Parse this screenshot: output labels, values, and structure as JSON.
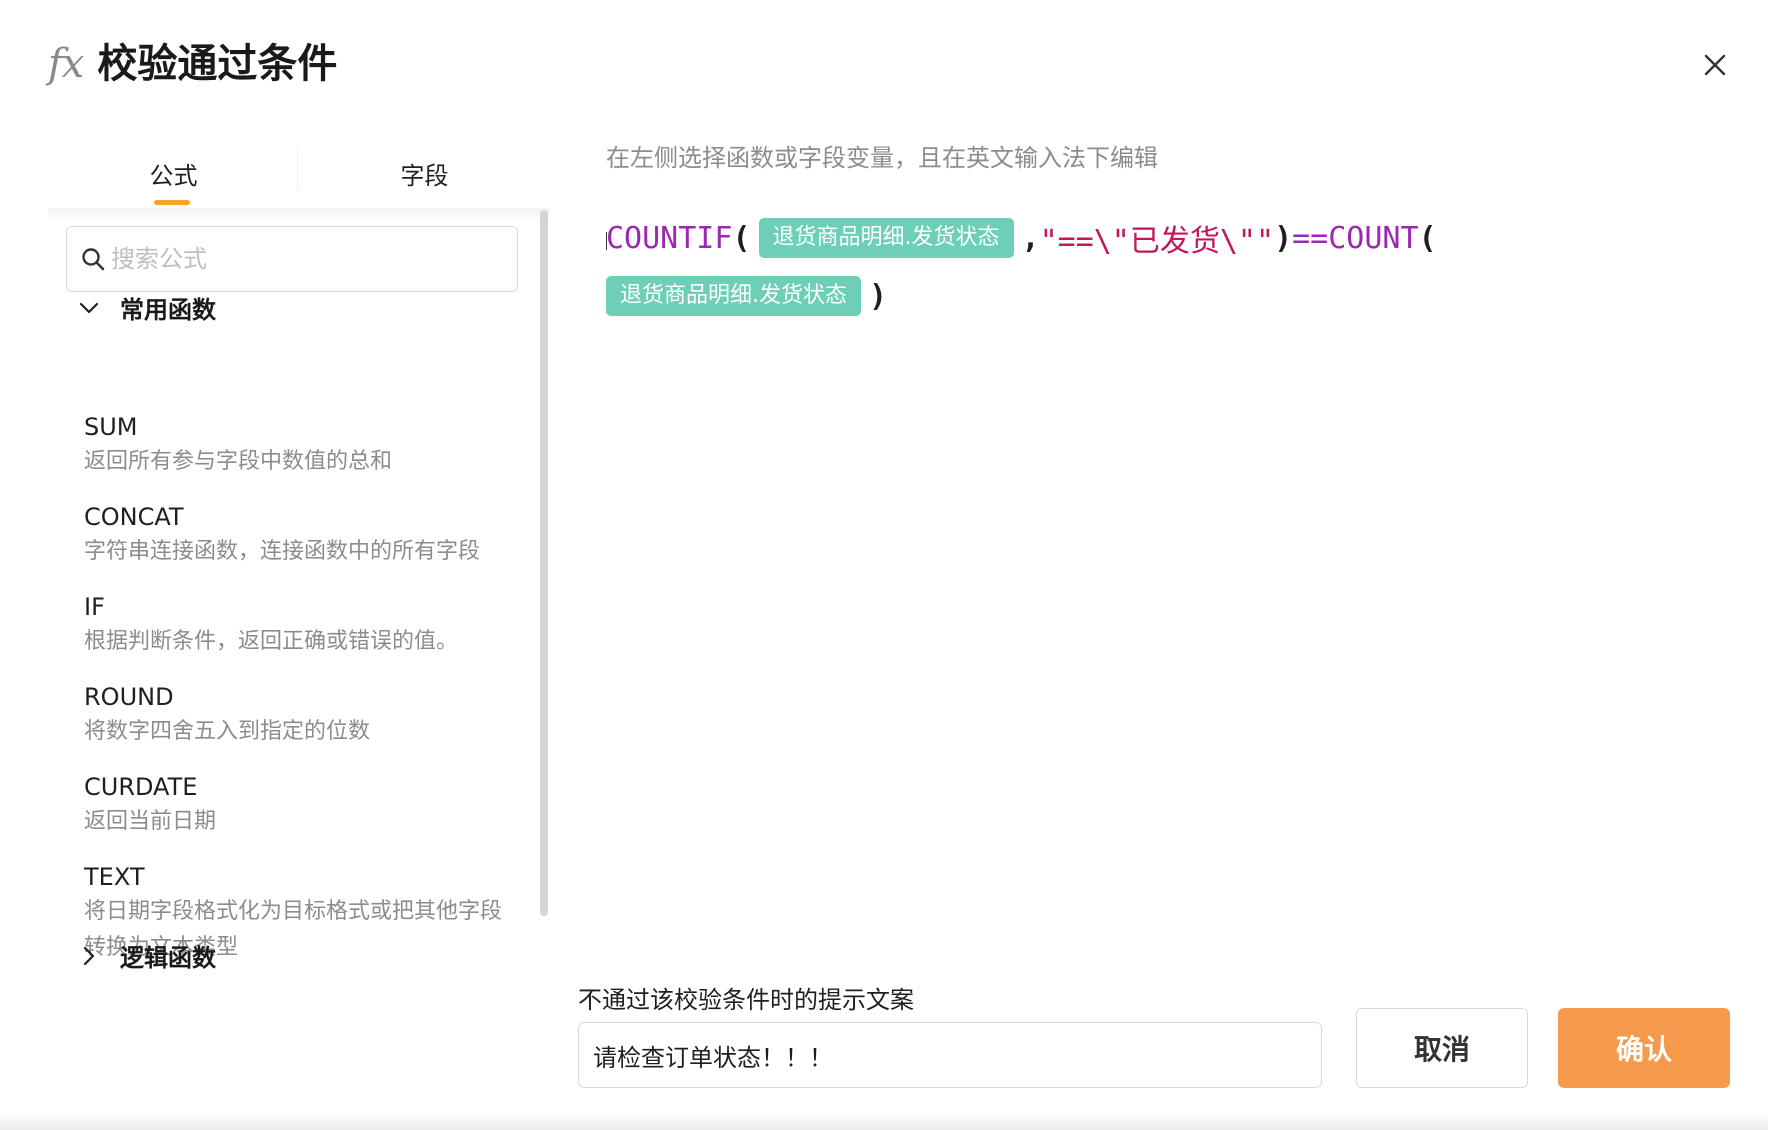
{
  "dialog": {
    "fx_symbol": "fx",
    "title": "校验通过条件"
  },
  "tabs": [
    {
      "label": "公式",
      "active": true
    },
    {
      "label": "字段",
      "active": false
    }
  ],
  "search": {
    "placeholder": "搜索公式",
    "value": ""
  },
  "groups": [
    {
      "label": "常用函数",
      "expanded": true
    },
    {
      "label": "逻辑函数",
      "expanded": false
    }
  ],
  "functions": [
    {
      "name": "SUM",
      "desc": "返回所有参与字段中数值的总和"
    },
    {
      "name": "CONCAT",
      "desc": "字符串连接函数，连接函数中的所有字段"
    },
    {
      "name": "IF",
      "desc": "根据判断条件，返回正确或错误的值。"
    },
    {
      "name": "ROUND",
      "desc": "将数字四舍五入到指定的位数"
    },
    {
      "name": "CURDATE",
      "desc": "返回当前日期"
    },
    {
      "name": "TEXT",
      "desc": "将日期字段格式化为目标格式或把其他字段转换为文本类型"
    }
  ],
  "editor": {
    "hint": "在左侧选择函数或字段变量，且在英文输入法下编辑",
    "fn_countif": "COUNTIF",
    "open_paren": "(",
    "field_1": "退货商品明细.发货状态",
    "comma": ",",
    "string_literal": "\"==\\\"已发货\\\"\"",
    "close_paren": ")",
    "operator": "==",
    "fn_count": "COUNT",
    "field_2": "退货商品明细.发货状态"
  },
  "message": {
    "label": "不通过该校验条件时的提示文案",
    "value": "请检查订单状态！！！"
  },
  "buttons": {
    "cancel": "取消",
    "confirm": "确认"
  },
  "colors": {
    "accent": "#f5a623",
    "confirm_bg": "#f59a4d",
    "field_tag_bg": "#6dcfb7",
    "function_color": "#9c27b0",
    "string_color": "#c2185b"
  }
}
